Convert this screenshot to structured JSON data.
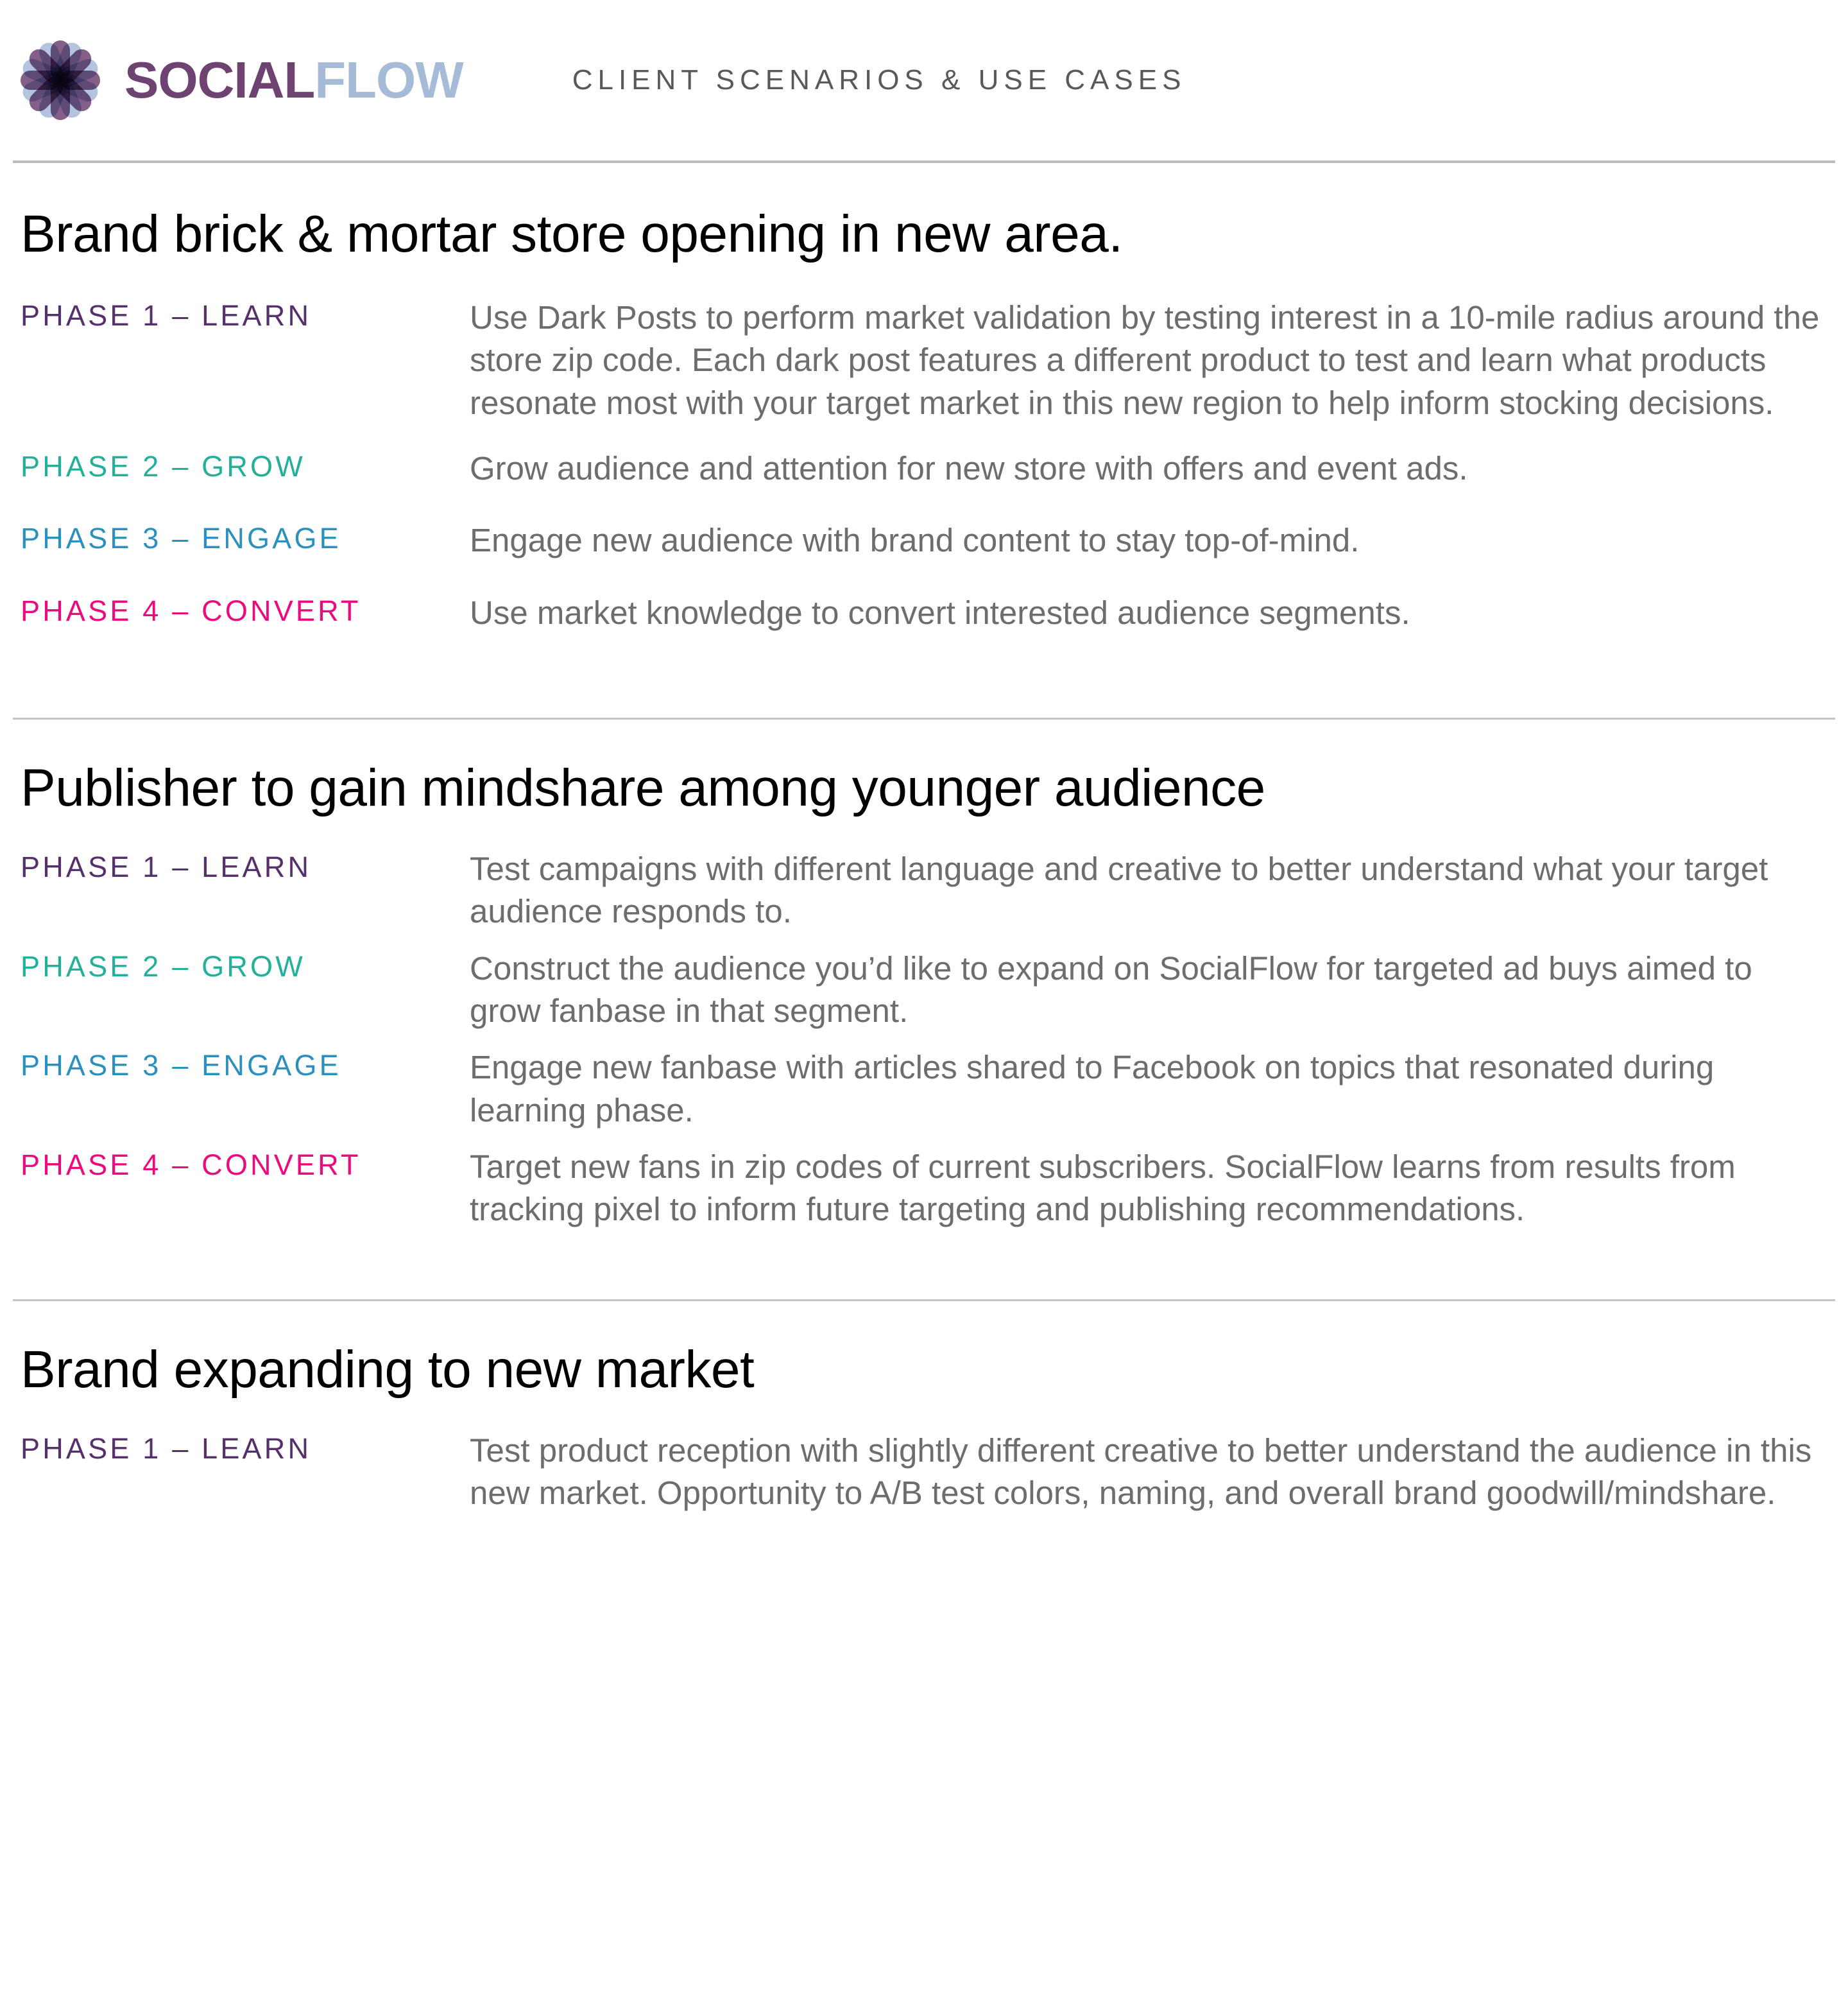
{
  "header": {
    "logo_icon": "socialflow-flower-icon",
    "brand_first": "SOCIAL",
    "brand_second": "FLOW",
    "title": "CLIENT SCENARIOS & USE CASES"
  },
  "colors": {
    "brand_purple": "#6E4372",
    "brand_blue": "#A6BBD8",
    "phase1_purple": "#56306A",
    "phase2_teal": "#22B09A",
    "phase3_blue": "#2C90BF",
    "phase4_magenta": "#EC0A7C",
    "body_gray": "#6D6D6D",
    "title_black": "#000000",
    "rule_gray": "#BCBCBC",
    "header_gray": "#595959"
  },
  "sections": [
    {
      "title": "Brand brick & mortar store opening in new area.",
      "phases": [
        {
          "label": "PHASE 1 – LEARN",
          "color_key": "phase1_purple",
          "body": "Use Dark Posts to perform market validation by testing interest in a 10-mile radius around the store zip code. Each dark post features a different product to test and learn what products resonate most with your target market in this new region to help inform stocking decisions."
        },
        {
          "label": "PHASE 2 – GROW",
          "color_key": "phase2_teal",
          "body": "Grow audience and attention for new store with offers and event ads."
        },
        {
          "label": "PHASE 3 – ENGAGE",
          "color_key": "phase3_blue",
          "body": "Engage new audience with brand content to stay top-of-mind."
        },
        {
          "label": "PHASE 4 – CONVERT",
          "color_key": "phase4_magenta",
          "body": "Use market knowledge to convert interested audience segments."
        }
      ]
    },
    {
      "title": "Publisher to gain mindshare among younger audience",
      "phases": [
        {
          "label": "PHASE 1 – LEARN",
          "color_key": "phase1_purple",
          "body": "Test campaigns with different language and creative to better understand what your target audience responds to."
        },
        {
          "label": "PHASE 2 – GROW",
          "color_key": "phase2_teal",
          "body": "Construct the audience you’d like to expand on SocialFlow for targeted ad buys aimed to grow fanbase in that segment."
        },
        {
          "label": "PHASE 3 – ENGAGE",
          "color_key": "phase3_blue",
          "body": "Engage new fanbase with articles shared to Facebook on topics that resonated during learning phase."
        },
        {
          "label": "PHASE 4 – CONVERT",
          "color_key": "phase4_magenta",
          "body": "Target new fans in zip codes of current subscribers. SocialFlow learns from results from tracking pixel to inform future targeting and publishing recommendations."
        }
      ]
    },
    {
      "title": "Brand expanding to new market",
      "phases": [
        {
          "label": "PHASE 1 – LEARN",
          "color_key": "phase1_purple",
          "body": "Test product reception with slightly different creative to better understand the audience in this new market. Opportunity to A/B test colors, naming, and overall brand goodwill/mindshare."
        }
      ]
    }
  ]
}
